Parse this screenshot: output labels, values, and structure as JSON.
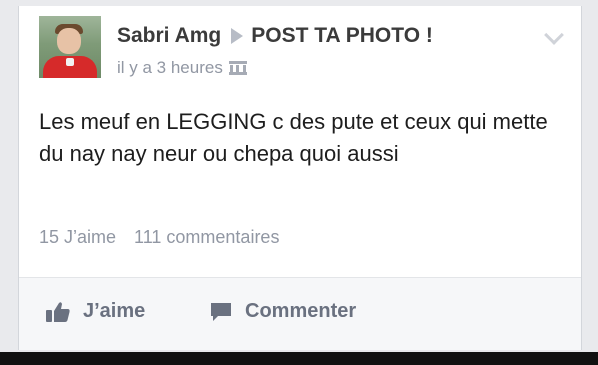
{
  "post": {
    "author": "Sabri Amg",
    "target_group": "POST TA PHOTO !",
    "timestamp": "il y a 3 heures",
    "audience_icon": "group-icon",
    "text": "Les meuf en LEGGING c des pute et ceux qui mette du nay nay neur ou chepa quoi aussi",
    "likes_text": "15 J’aime",
    "comments_text": "111 commentaires"
  },
  "actions": {
    "like_label": "J’aime",
    "like_icon": "thumbs-up-icon",
    "comment_label": "Commenter",
    "comment_icon": "speech-bubble-icon"
  },
  "colors": {
    "card_background": "#ffffff",
    "page_background": "#e9eaed",
    "author_text": "#3b3b3b",
    "meta_text": "#9197a3",
    "action_text": "#6a7180"
  }
}
